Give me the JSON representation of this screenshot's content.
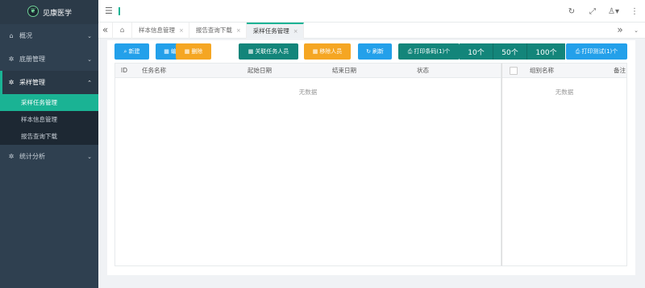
{
  "app": {
    "logo_glyph": "❦",
    "name": "见康医学"
  },
  "sidebar": {
    "items": [
      {
        "label": "概况",
        "icon": "⌂",
        "chev": "⌄"
      },
      {
        "label": "底册管理",
        "icon": "✲",
        "chev": "⌄"
      },
      {
        "label": "采样管理",
        "icon": "✲",
        "chev": "⌃"
      },
      {
        "label": "统计分析",
        "icon": "✲",
        "chev": "⌄"
      }
    ],
    "sub_items": [
      {
        "label": "采样任务管理"
      },
      {
        "label": "样本信息管理"
      },
      {
        "label": "报告查询下载"
      }
    ]
  },
  "topbar": {
    "menu_icon": "☰",
    "refresh_icon": "↻",
    "fullscreen_icon": "⤢",
    "user_icon": "♙▾",
    "more_icon": "⋮"
  },
  "tabs": {
    "left_icon": "«",
    "home_icon": "⌂",
    "right_icon": "»",
    "down_icon": "⌄",
    "close_glyph": "×",
    "items": [
      {
        "label": "样本信息管理"
      },
      {
        "label": "报告查询下载"
      },
      {
        "label": "采样任务管理"
      }
    ]
  },
  "toolbar": {
    "new": {
      "icon": "⌕",
      "label": "新建"
    },
    "edit": {
      "icon": "▦",
      "label": "编辑"
    },
    "delete": {
      "icon": "▦",
      "label": "删除"
    },
    "link_staff": {
      "icon": "▦",
      "label": "关联任务人员"
    },
    "remove_staff": {
      "icon": "▦",
      "label": "移除人员"
    },
    "refresh": {
      "icon": "↻",
      "label": "刷新"
    },
    "print_barcode": {
      "icon": "⎙",
      "label": "打印条码(1)个"
    },
    "count_options": [
      "10个",
      "50个",
      "100个"
    ],
    "print_test": {
      "icon": "⎙",
      "label": "打印测试(1)个"
    }
  },
  "table_left": {
    "columns": [
      "ID",
      "任务名称",
      "起始日期",
      "结束日期",
      "状态"
    ],
    "empty": "无数据"
  },
  "table_right": {
    "columns": [
      "组别名称",
      "备注"
    ],
    "empty": "无数据"
  },
  "colors": {
    "accent": "#1ab394",
    "sidebar": "#2f4050",
    "blue": "#23a0ea",
    "yellow": "#f5a623",
    "teal": "#13857a"
  }
}
